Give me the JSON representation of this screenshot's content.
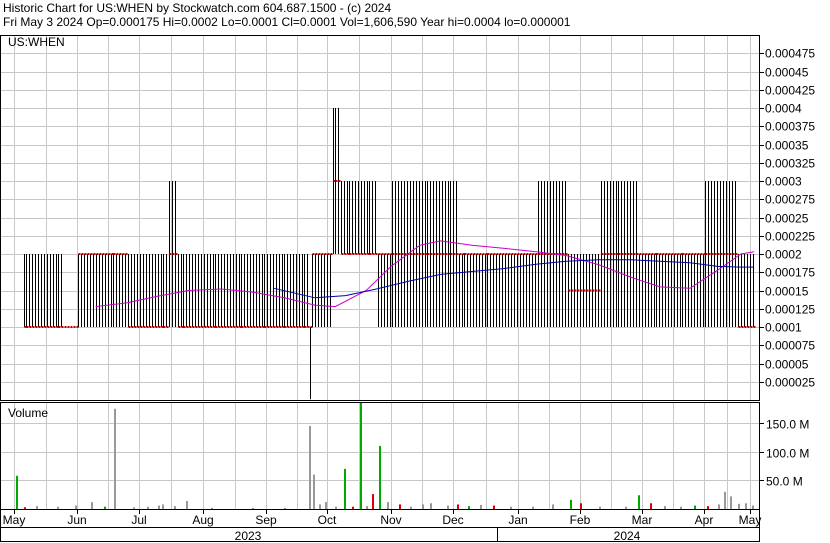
{
  "header": {
    "line1": "Historic Chart for US:WHEN by Stockwatch.com 604.687.1500 - (c) 2024",
    "line2": "Fri May  3 2024   Op=0.000175   Hi=0.0002   Lo=0.0001   Cl=0.0001   Vol=1,606,590   Year hi=0.0004   lo=0.000001"
  },
  "chart_data": {
    "type": "bar",
    "symbol_label": "US:WHEN",
    "volume_label": "Volume",
    "price_axis": {
      "ylim": [
        0,
        0.0005
      ],
      "ticks": [
        "0.000475",
        "0.00045",
        "0.000425",
        "0.0004",
        "0.000375",
        "0.00035",
        "0.000325",
        "0.0003",
        "0.000275",
        "0.00025",
        "0.000225",
        "0.0002",
        "0.000175",
        "0.00015",
        "0.000125",
        "0.0001",
        "0.000075",
        "0.00005",
        "0.000025"
      ]
    },
    "volume_axis": {
      "ylim": [
        0,
        185
      ],
      "tick_values": [
        150,
        100,
        50
      ],
      "tick_labels": [
        "150.0 M",
        "100.0 M",
        "50.0 M"
      ]
    },
    "x_axis": {
      "months": [
        "May",
        "Jun",
        "Jul",
        "Aug",
        "Sep",
        "Oct",
        "Nov",
        "Dec",
        "Jan",
        "Feb",
        "Mar",
        "Apr",
        "May"
      ],
      "years": [
        "2023",
        "2024"
      ]
    },
    "colors": {
      "price_bar": "#000000",
      "close_marker": "#cc0000",
      "ma_short": "#cc00cc",
      "ma_long": "#0000aa",
      "volume_up": "#00aa00",
      "volume_down": "#dd0000",
      "volume_flat": "#999999",
      "grid": "#c8c8c8"
    },
    "moving_average_short": [
      {
        "x": "2023-06-10",
        "y": 0.000128
      },
      {
        "x": "2023-06-25",
        "y": 0.000133
      },
      {
        "x": "2023-07-10",
        "y": 0.000142
      },
      {
        "x": "2023-07-25",
        "y": 0.00015
      },
      {
        "x": "2023-08-10",
        "y": 0.000152
      },
      {
        "x": "2023-08-25",
        "y": 0.000148
      },
      {
        "x": "2023-09-10",
        "y": 0.00014
      },
      {
        "x": "2023-09-25",
        "y": 0.00013
      },
      {
        "x": "2023-10-05",
        "y": 0.000128
      },
      {
        "x": "2023-10-20",
        "y": 0.00015
      },
      {
        "x": "2023-11-01",
        "y": 0.000183
      },
      {
        "x": "2023-11-15",
        "y": 0.000212
      },
      {
        "x": "2023-11-25",
        "y": 0.000218
      },
      {
        "x": "2023-12-10",
        "y": 0.000212
      },
      {
        "x": "2023-12-25",
        "y": 0.000208
      },
      {
        "x": "2024-01-10",
        "y": 0.000203
      },
      {
        "x": "2024-01-25",
        "y": 0.000198
      },
      {
        "x": "2024-02-10",
        "y": 0.000185
      },
      {
        "x": "2024-02-25",
        "y": 0.000168
      },
      {
        "x": "2024-03-10",
        "y": 0.000155
      },
      {
        "x": "2024-03-25",
        "y": 0.000153
      },
      {
        "x": "2024-04-10",
        "y": 0.000178
      },
      {
        "x": "2024-04-25",
        "y": 0.0002
      },
      {
        "x": "2024-05-03",
        "y": 0.000203
      }
    ],
    "moving_average_long": [
      {
        "x": "2023-09-05",
        "y": 0.000153
      },
      {
        "x": "2023-09-25",
        "y": 0.00014
      },
      {
        "x": "2023-10-10",
        "y": 0.000143
      },
      {
        "x": "2023-10-25",
        "y": 0.000152
      },
      {
        "x": "2023-11-10",
        "y": 0.000163
      },
      {
        "x": "2023-11-25",
        "y": 0.000172
      },
      {
        "x": "2023-12-10",
        "y": 0.000176
      },
      {
        "x": "2023-12-25",
        "y": 0.00018
      },
      {
        "x": "2024-01-10",
        "y": 0.000186
      },
      {
        "x": "2024-01-25",
        "y": 0.00019
      },
      {
        "x": "2024-02-10",
        "y": 0.000192
      },
      {
        "x": "2024-02-25",
        "y": 0.000192
      },
      {
        "x": "2024-03-10",
        "y": 0.00019
      },
      {
        "x": "2024-03-25",
        "y": 0.000188
      },
      {
        "x": "2024-04-10",
        "y": 0.000183
      },
      {
        "x": "2024-04-25",
        "y": 0.000182
      },
      {
        "x": "2024-05-03",
        "y": 0.000182
      }
    ],
    "price_bar_groups": [
      {
        "x_start": "2023-05-05",
        "x_end": "2023-05-25",
        "low": 0.0001,
        "high": 0.0002,
        "close": 0.0001
      },
      {
        "x_start": "2023-05-25",
        "x_end": "2023-06-01",
        "low": 0.0001,
        "high": 0.0001,
        "close": 0.0001
      },
      {
        "x_start": "2023-06-01",
        "x_end": "2023-06-25",
        "low": 0.0001,
        "high": 0.0002,
        "close": 0.0002
      },
      {
        "x_start": "2023-06-25",
        "x_end": "2023-07-05",
        "low": 0.0001,
        "high": 0.0002,
        "close": 0.0001
      },
      {
        "x_start": "2023-07-05",
        "x_end": "2023-07-15",
        "low": 0.0001,
        "high": 0.0002,
        "close": 0.0001
      },
      {
        "x_start": "2023-07-15",
        "x_end": "2023-07-19",
        "low": 0.0001,
        "high": 0.0003,
        "close": 0.0002
      },
      {
        "x_start": "2023-07-19",
        "x_end": "2023-08-15",
        "low": 0.0001,
        "high": 0.0002,
        "close": 0.0001
      },
      {
        "x_start": "2023-08-15",
        "x_end": "2023-09-15",
        "low": 0.0001,
        "high": 0.0002,
        "close": 0.0001
      },
      {
        "x_start": "2023-09-15",
        "x_end": "2023-09-22",
        "low": 0.0001,
        "high": 0.0002,
        "close": 0.0001
      },
      {
        "x_start": "2023-09-22",
        "x_end": "2023-09-23",
        "low": 1e-06,
        "high": 0.0001,
        "close": 0.0001
      },
      {
        "x_start": "2023-09-23",
        "x_end": "2023-10-03",
        "low": 0.0001,
        "high": 0.0002,
        "close": 0.0002
      },
      {
        "x_start": "2023-10-03",
        "x_end": "2023-10-07",
        "low": 0.0002,
        "high": 0.0004,
        "close": 0.0003
      },
      {
        "x_start": "2023-10-07",
        "x_end": "2023-10-25",
        "low": 0.0002,
        "high": 0.0003,
        "close": 0.0002
      },
      {
        "x_start": "2023-10-25",
        "x_end": "2023-11-01",
        "low": 0.0001,
        "high": 0.0002,
        "close": 0.0002
      },
      {
        "x_start": "2023-11-01",
        "x_end": "2023-11-25",
        "low": 0.0001,
        "high": 0.0003,
        "close": 0.0002
      },
      {
        "x_start": "2023-11-25",
        "x_end": "2023-12-03",
        "low": 0.0001,
        "high": 0.0003,
        "close": 0.0002
      },
      {
        "x_start": "2023-12-03",
        "x_end": "2023-12-25",
        "low": 0.0001,
        "high": 0.0002,
        "close": 0.0002
      },
      {
        "x_start": "2023-12-25",
        "x_end": "2024-01-10",
        "low": 0.0001,
        "high": 0.0002,
        "close": 0.0002
      },
      {
        "x_start": "2024-01-10",
        "x_end": "2024-01-25",
        "low": 0.0001,
        "high": 0.0003,
        "close": 0.0002
      },
      {
        "x_start": "2024-01-25",
        "x_end": "2024-02-10",
        "low": 0.0001,
        "high": 0.0002,
        "close": 0.00015
      },
      {
        "x_start": "2024-02-10",
        "x_end": "2024-02-28",
        "low": 0.0001,
        "high": 0.0003,
        "close": 0.0002
      },
      {
        "x_start": "2024-02-28",
        "x_end": "2024-04-01",
        "low": 0.0001,
        "high": 0.0002,
        "close": 0.0002
      },
      {
        "x_start": "2024-04-01",
        "x_end": "2024-04-22",
        "low": 0.0001,
        "high": 0.0003,
        "close": 0.0002
      },
      {
        "x_start": "2024-04-22",
        "x_end": "2024-05-03",
        "low": 0.0001,
        "high": 0.0002,
        "close": 0.0001
      }
    ],
    "volume_bars": [
      {
        "x": "2023-05-02",
        "value": 58,
        "dir": "up"
      },
      {
        "x": "2023-05-06",
        "value": 3,
        "dir": "down"
      },
      {
        "x": "2023-05-12",
        "value": 5,
        "dir": "flat"
      },
      {
        "x": "2023-05-22",
        "value": 4,
        "dir": "flat"
      },
      {
        "x": "2023-05-31",
        "value": 6,
        "dir": "flat"
      },
      {
        "x": "2023-06-08",
        "value": 12,
        "dir": "flat"
      },
      {
        "x": "2023-06-14",
        "value": 4,
        "dir": "up"
      },
      {
        "x": "2023-06-19",
        "value": 175,
        "dir": "flat"
      },
      {
        "x": "2023-06-28",
        "value": 3,
        "dir": "flat"
      },
      {
        "x": "2023-07-05",
        "value": 4,
        "dir": "flat"
      },
      {
        "x": "2023-07-10",
        "value": 6,
        "dir": "flat"
      },
      {
        "x": "2023-07-12",
        "value": 8,
        "dir": "flat"
      },
      {
        "x": "2023-07-18",
        "value": 5,
        "dir": "flat"
      },
      {
        "x": "2023-07-24",
        "value": 14,
        "dir": "flat"
      },
      {
        "x": "2023-08-05",
        "value": 2,
        "dir": "flat"
      },
      {
        "x": "2023-08-25",
        "value": 2,
        "dir": "flat"
      },
      {
        "x": "2023-09-10",
        "value": 2,
        "dir": "flat"
      },
      {
        "x": "2023-09-22",
        "value": 145,
        "dir": "flat"
      },
      {
        "x": "2023-09-24",
        "value": 60,
        "dir": "flat"
      },
      {
        "x": "2023-09-27",
        "value": 8,
        "dir": "flat"
      },
      {
        "x": "2023-09-30",
        "value": 12,
        "dir": "flat"
      },
      {
        "x": "2023-10-05",
        "value": 4,
        "dir": "flat"
      },
      {
        "x": "2023-10-09",
        "value": 70,
        "dir": "up"
      },
      {
        "x": "2023-10-13",
        "value": 4,
        "dir": "down"
      },
      {
        "x": "2023-10-17",
        "value": 186,
        "dir": "up"
      },
      {
        "x": "2023-10-20",
        "value": 5,
        "dir": "flat"
      },
      {
        "x": "2023-10-23",
        "value": 26,
        "dir": "down"
      },
      {
        "x": "2023-10-26",
        "value": 110,
        "dir": "up"
      },
      {
        "x": "2023-10-30",
        "value": 12,
        "dir": "flat"
      },
      {
        "x": "2023-11-05",
        "value": 8,
        "dir": "down"
      },
      {
        "x": "2023-11-10",
        "value": 4,
        "dir": "flat"
      },
      {
        "x": "2023-11-16",
        "value": 8,
        "dir": "flat"
      },
      {
        "x": "2023-11-20",
        "value": 10,
        "dir": "flat"
      },
      {
        "x": "2023-11-28",
        "value": 6,
        "dir": "flat"
      },
      {
        "x": "2023-12-03",
        "value": 8,
        "dir": "down"
      },
      {
        "x": "2023-12-08",
        "value": 5,
        "dir": "up"
      },
      {
        "x": "2023-12-14",
        "value": 7,
        "dir": "flat"
      },
      {
        "x": "2023-12-20",
        "value": 6,
        "dir": "down"
      },
      {
        "x": "2023-12-28",
        "value": 4,
        "dir": "flat"
      },
      {
        "x": "2024-01-08",
        "value": 4,
        "dir": "flat"
      },
      {
        "x": "2024-01-18",
        "value": 8,
        "dir": "flat"
      },
      {
        "x": "2024-01-27",
        "value": 16,
        "dir": "up"
      },
      {
        "x": "2024-02-01",
        "value": 10,
        "dir": "down"
      },
      {
        "x": "2024-02-10",
        "value": 4,
        "dir": "flat"
      },
      {
        "x": "2024-02-22",
        "value": 4,
        "dir": "flat"
      },
      {
        "x": "2024-02-28",
        "value": 24,
        "dir": "up"
      },
      {
        "x": "2024-03-05",
        "value": 10,
        "dir": "down"
      },
      {
        "x": "2024-03-12",
        "value": 5,
        "dir": "flat"
      },
      {
        "x": "2024-03-20",
        "value": 4,
        "dir": "flat"
      },
      {
        "x": "2024-03-27",
        "value": 6,
        "dir": "up"
      },
      {
        "x": "2024-04-03",
        "value": 5,
        "dir": "down"
      },
      {
        "x": "2024-04-10",
        "value": 8,
        "dir": "flat"
      },
      {
        "x": "2024-04-14",
        "value": 30,
        "dir": "flat"
      },
      {
        "x": "2024-04-18",
        "value": 22,
        "dir": "flat"
      },
      {
        "x": "2024-04-23",
        "value": 9,
        "dir": "flat"
      },
      {
        "x": "2024-04-28",
        "value": 10,
        "dir": "flat"
      },
      {
        "x": "2024-05-02",
        "value": 6,
        "dir": "flat"
      }
    ]
  }
}
